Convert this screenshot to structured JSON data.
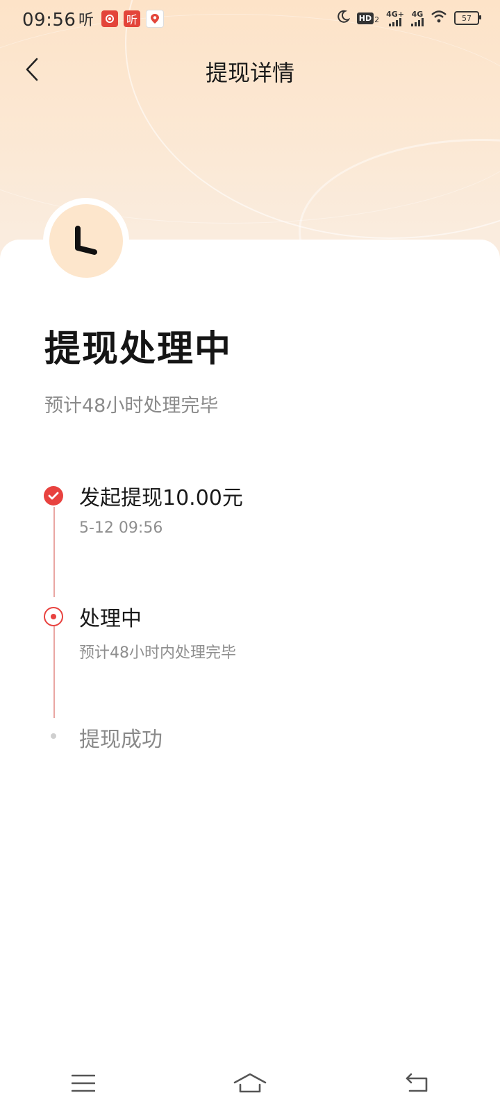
{
  "status_bar": {
    "time": "09:56",
    "icon_ting": "听",
    "icon_ting_red": "听",
    "hd_label": "HD",
    "hd_sub": "2",
    "signal1_label": "4G+",
    "signal2_label": "4G",
    "battery": "57",
    "icons": [
      "moon-icon",
      "wifi-icon",
      "battery-icon"
    ]
  },
  "header": {
    "title": "提现详情",
    "back_icon": "chevron-left-icon"
  },
  "status": {
    "icon": "clock-icon",
    "title": "提现处理中",
    "subtitle": "预计48小时处理完毕"
  },
  "timeline": {
    "steps": [
      {
        "title": "发起提现10.00元",
        "subtitle": "5-12 09:56",
        "state": "done"
      },
      {
        "title": "处理中",
        "subtitle": "预计48小时内处理完毕",
        "state": "current"
      },
      {
        "title": "提现成功",
        "subtitle": "",
        "state": "pending"
      }
    ]
  },
  "system_nav": {
    "items": [
      "menu-icon",
      "home-icon",
      "back-icon"
    ]
  },
  "colors": {
    "accent": "#e8423f",
    "hero_bg": "#fde3c8",
    "clock_bg": "#fde6cc",
    "line": "#e9a6a2"
  }
}
